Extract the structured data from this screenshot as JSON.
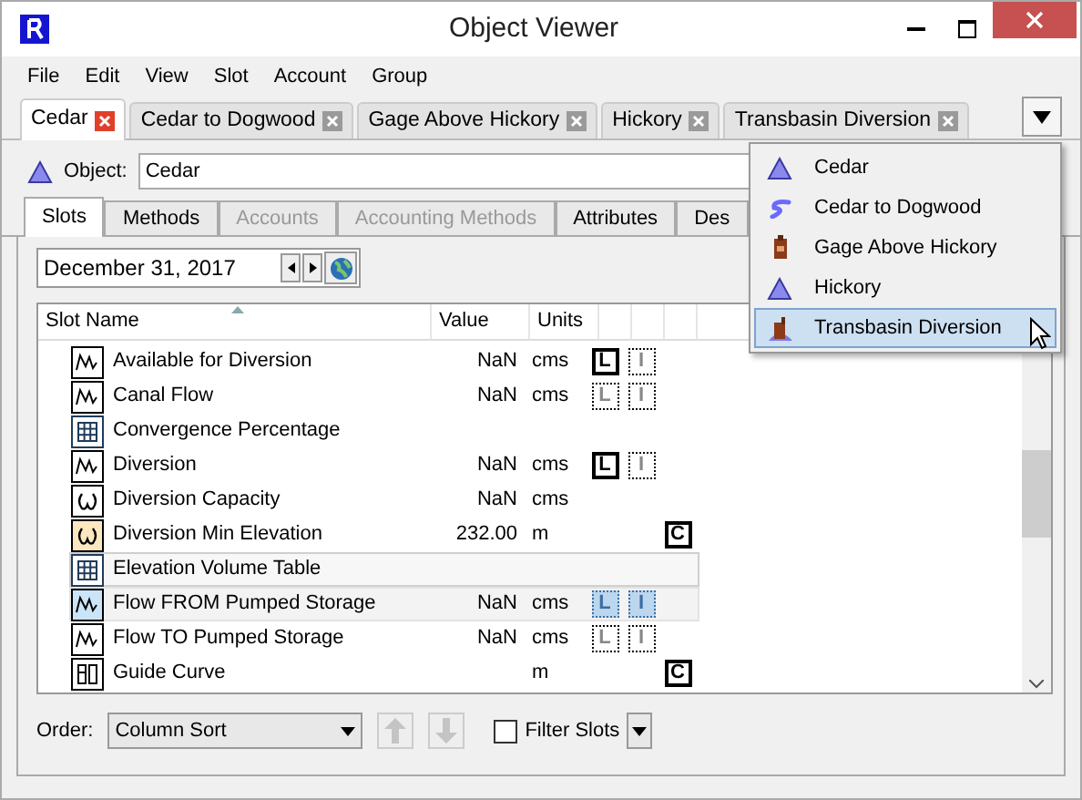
{
  "window": {
    "title": "Object Viewer"
  },
  "menu": [
    "File",
    "Edit",
    "View",
    "Slot",
    "Account",
    "Group"
  ],
  "tabs": [
    {
      "label": "Cedar",
      "selected": true
    },
    {
      "label": "Cedar to Dogwood",
      "selected": false
    },
    {
      "label": "Gage Above Hickory",
      "selected": false
    },
    {
      "label": "Hickory",
      "selected": false
    },
    {
      "label": "Transbasin Diversion",
      "selected": false
    }
  ],
  "object": {
    "label": "Object:",
    "value": "Cedar"
  },
  "sub_tabs": [
    {
      "label": "Slots",
      "selected": true,
      "disabled": false
    },
    {
      "label": "Methods",
      "selected": false,
      "disabled": false
    },
    {
      "label": "Accounts",
      "selected": false,
      "disabled": true
    },
    {
      "label": "Accounting Methods",
      "selected": false,
      "disabled": true
    },
    {
      "label": "Attributes",
      "selected": false,
      "disabled": false
    },
    {
      "label": "Des",
      "selected": false,
      "disabled": false
    }
  ],
  "date": {
    "value": "December 31, 2017"
  },
  "table": {
    "columns": [
      "Slot Name",
      "Value",
      "Units"
    ],
    "rows": [
      {
        "kind": "series",
        "name": "Available for Diversion",
        "value": "NaN",
        "units": "cms",
        "selected": false,
        "highlighted": false,
        "flag_1": {
          "letter": "L",
          "kind": "active"
        },
        "flag_2": {
          "letter": "I",
          "kind": "inactive"
        }
      },
      {
        "kind": "series",
        "name": "Canal Flow",
        "value": "NaN",
        "units": "cms",
        "selected": false,
        "highlighted": false,
        "flag_1": {
          "letter": "L",
          "kind": "inactive"
        },
        "flag_2": {
          "letter": "I",
          "kind": "inactive"
        }
      },
      {
        "kind": "table",
        "name": "Convergence Percentage",
        "selected": false,
        "highlighted": false
      },
      {
        "kind": "series",
        "name": "Diversion",
        "value": "NaN",
        "units": "cms",
        "selected": false,
        "highlighted": false,
        "flag_1": {
          "letter": "L",
          "kind": "active"
        },
        "flag_2": {
          "letter": "I",
          "kind": "inactive"
        }
      },
      {
        "kind": "scalar",
        "name": "Diversion Capacity",
        "value": "NaN",
        "units": "cms",
        "selected": false,
        "highlighted": false
      },
      {
        "kind": "scalar_set",
        "name": "Diversion Min Elevation",
        "value": "232.00",
        "units": "m",
        "selected": false,
        "highlighted": false,
        "flag_3": {
          "letter": "C",
          "kind": "active"
        }
      },
      {
        "kind": "table",
        "name": "Elevation Volume Table",
        "selected": false,
        "highlighted": true
      },
      {
        "kind": "series",
        "name": "Flow FROM Pumped Storage",
        "value": "NaN",
        "units": "cms",
        "selected": true,
        "highlighted": false,
        "flag_1": {
          "letter": "L",
          "kind": "inactive"
        },
        "flag_2": {
          "letter": "I",
          "kind": "inactive"
        }
      },
      {
        "kind": "series",
        "name": "Flow TO Pumped Storage",
        "value": "NaN",
        "units": "cms",
        "selected": false,
        "highlighted": false,
        "flag_1": {
          "letter": "L",
          "kind": "inactive"
        },
        "flag_2": {
          "letter": "I",
          "kind": "inactive"
        }
      },
      {
        "kind": "periodic",
        "name": "Guide Curve",
        "units": "m",
        "selected": false,
        "highlighted": false,
        "flag_3": {
          "letter": "C",
          "kind": "active"
        }
      }
    ]
  },
  "order": {
    "label": "Order:",
    "value": "Column Sort"
  },
  "filter": {
    "label": "Filter Slots",
    "checked": false
  },
  "dropdown_menu": [
    {
      "kind": "reservoir",
      "label": "Cedar",
      "selected": false
    },
    {
      "kind": "reach",
      "label": "Cedar to Dogwood",
      "selected": false
    },
    {
      "kind": "gage",
      "label": "Gage Above Hickory",
      "selected": false
    },
    {
      "kind": "reservoir",
      "label": "Hickory",
      "selected": false
    },
    {
      "kind": "diversion",
      "label": "Transbasin Diversion",
      "selected": true
    }
  ]
}
